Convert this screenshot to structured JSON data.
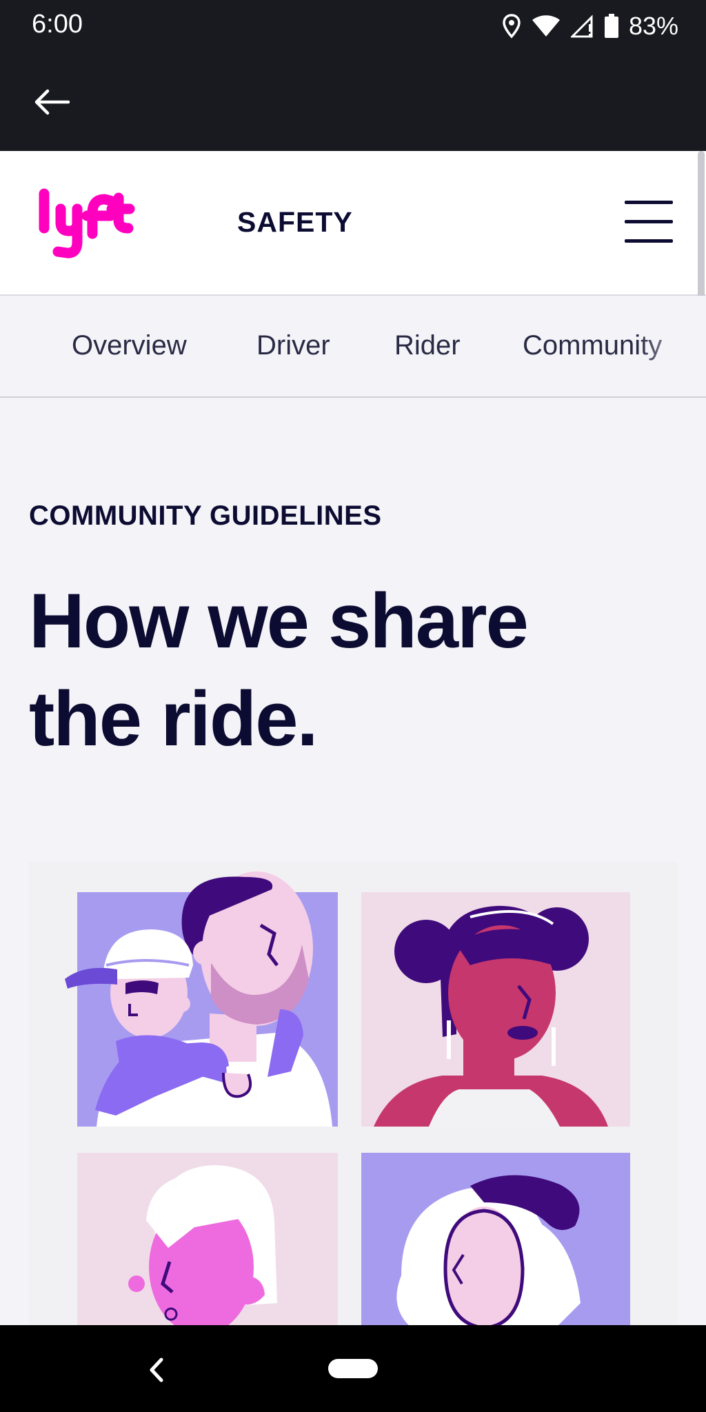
{
  "status": {
    "time": "6:00",
    "battery": "83%"
  },
  "header": {
    "brand": "lyft",
    "section": "SAFETY",
    "brand_color": "#ff00bf"
  },
  "tabs": [
    "Overview",
    "Driver",
    "Rider",
    "Community"
  ],
  "page": {
    "eyebrow": "COMMUNITY GUIDELINES",
    "headline_line1": "How we share",
    "headline_line2": "the ride."
  },
  "icons": {
    "status": [
      "location-icon",
      "wifi-icon",
      "signal-icon",
      "battery-icon"
    ],
    "appbar": "back-arrow-icon",
    "header": "hamburger-menu-icon",
    "system_nav": [
      "back-icon",
      "home-pill-icon"
    ]
  }
}
